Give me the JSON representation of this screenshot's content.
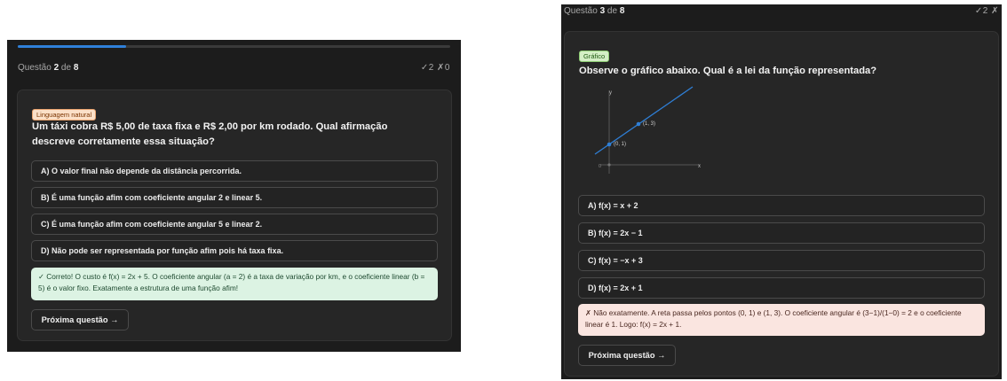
{
  "left_quiz": {
    "progress": 0.25,
    "header": {
      "prefix": "Questão ",
      "current": "2",
      "of": " de ",
      "total": "8",
      "score": "✓2  ✗0"
    },
    "tag": "Linguagem natural",
    "question": "Um táxi cobra R$ 5,00 de taxa fixa e R$ 2,00 por km rodado. Qual afirmação descreve corretamente essa situação?",
    "options": [
      "A) O valor final não depende da distância percorrida.",
      "B) É uma função afim com coeficiente angular 2 e linear 5.",
      "C) É uma função afim com coeficiente angular 5 e linear 2.",
      "D) Não pode ser representada por função afim pois há taxa fixa."
    ],
    "feedback": "✓ Correto! O custo é f(x) = 2x + 5. O coeficiente angular (a = 2) é a taxa de variação por km, e o coeficiente linear (b = 5) é o valor fixo. Exatamente a estrutura de uma função afim!",
    "next_label": "Próxima questão →"
  },
  "right_quiz": {
    "header": {
      "prefix": "Questão ",
      "current": "3",
      "of": " de ",
      "total": "8",
      "score": "✓2  ✗"
    },
    "tag": "Gráfico",
    "question": "Observe o gráfico abaixo. Qual é a lei da função representada?",
    "graph": {
      "y_axis_label": "y",
      "x_axis_label": "x",
      "origin_label": "0",
      "point_labels": [
        "(0, 1)",
        "(1, 3)"
      ],
      "line_color": "#2f7fd6"
    },
    "options": [
      "A) f(x) = x + 2",
      "B) f(x) = 2x − 1",
      "C) f(x) = −x + 3",
      "D) f(x) = 2x + 1"
    ],
    "feedback": "✗ Não exatamente. A reta passa pelos pontos (0, 1) e (1, 3). O coeficiente angular é (3−1)/(1−0) = 2 e o coeficiente linear é 1. Logo: f(x) = 2x + 1.",
    "next_label": "Próxima questão →"
  },
  "colors": {
    "panel_bg": "#1c1c1c",
    "card_bg": "#262626",
    "accent_blue": "#2f80d9",
    "correct_bg": "#dcf3e3",
    "wrong_bg": "#fae5e0"
  }
}
